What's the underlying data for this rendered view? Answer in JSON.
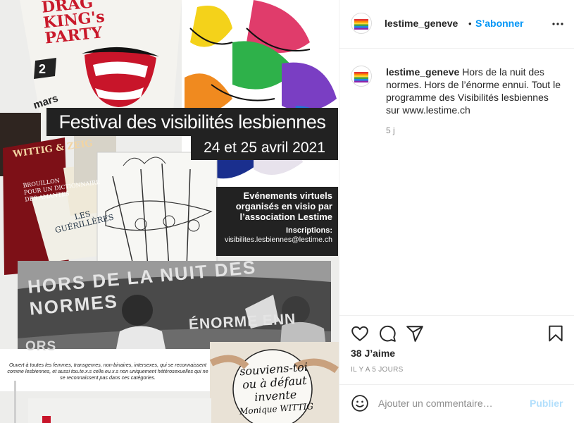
{
  "post": {
    "username": "lestime_geneve",
    "separator": "•",
    "follow_label": "S’abonner",
    "more_icon": "more-options-icon",
    "caption": {
      "username": "lestime_geneve",
      "text": "Hors de la nuit des normes. Hors de l’énorme ennui. Tout le programme des Visibilités lesbiennes sur www.lestime.ch",
      "time": "5 j"
    },
    "likes": "38 J’aime",
    "date_ago": "IL Y A 5 JOURS",
    "comment_placeholder": "Ajouter un commentaire…",
    "publish_label": "Publier",
    "colors": {
      "accent": "#0095f6",
      "publish_disabled": "#b2dffc",
      "muted": "#8e8e8e"
    }
  },
  "poster": {
    "title": "Festival des visibilités lesbiennes",
    "dates": "24 et 25 avril 2021",
    "events_line_1": "Evénements virtuels",
    "events_line_2": "organisés en visio par",
    "events_line_3": "l’association Lestime",
    "registration_label": "Inscriptions:",
    "registration_email": "visibilites.lesbiennes@lestime.ch",
    "drag_1": "DRAG",
    "drag_2": "KING's",
    "drag_3": "PARTY",
    "mars": "mars",
    "banner_1": "HORS DE LA NUIT DES NORMES",
    "banner_2": "ÉNORME ENN",
    "banner_3": "ORS",
    "book_1": "WITTIG & ZEIG",
    "book_2_line_1": "BROUILLON",
    "book_2_line_2": "POUR UN DICTIONNAIRE",
    "book_2_line_3": "DES AMANTES",
    "book_3_line_1": "LES",
    "book_3_line_2": "GUÉRILLÈRES",
    "footer_note": "Ouvert à toutes les femmes, transgenres, non-binaires, intersexes, qui se reconnaissent comme lesbiennes, et aussi tou.te.x.s celle.eu.x.s non uniquement hétérosexuelles qui ne se reconnaissent pas dans ces catégories.",
    "hand_line_1": "souviens-toi",
    "hand_line_2": "ou à défaut",
    "hand_line_3": "invente",
    "hand_line_4": "Monique WITTIG"
  }
}
